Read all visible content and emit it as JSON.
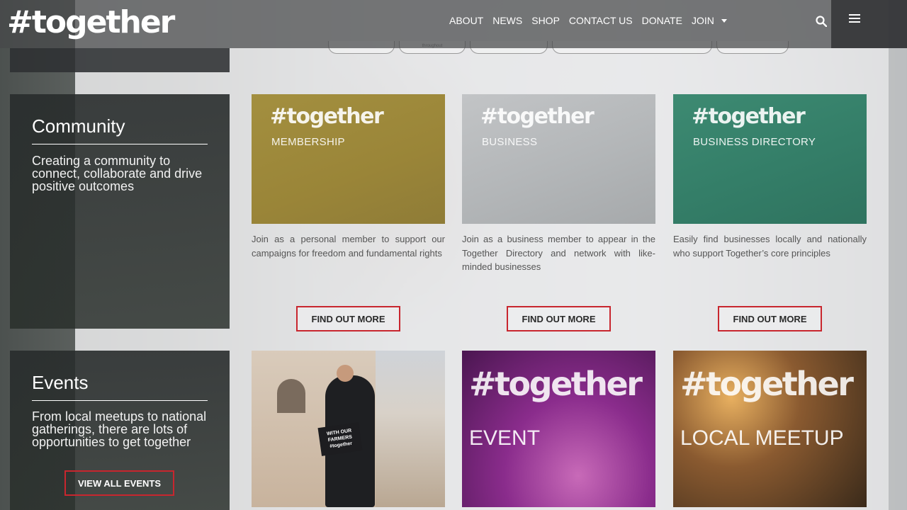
{
  "header": {
    "logo": "#together",
    "nav": [
      {
        "label": "ABOUT"
      },
      {
        "label": "NEWS"
      },
      {
        "label": "SHOP"
      },
      {
        "label": "CONTACT US"
      },
      {
        "label": "DONATE"
      },
      {
        "label": "JOIN"
      }
    ]
  },
  "pills": {
    "second_label": "throughout"
  },
  "community": {
    "title": "Community",
    "description": "Creating a community to connect, collaborate and drive positive outcomes"
  },
  "tiles": [
    {
      "logo": "#together",
      "subtitle": "MEMBERSHIP",
      "description": "Join as a personal member to support our campaigns for freedom and fundamental rights",
      "button": "FIND OUT MORE",
      "color": "#a48f3c"
    },
    {
      "logo": "#together",
      "subtitle": "BUSINESS",
      "description": "Join as a business member to appear in the Together Directory and network with like-minded businesses",
      "button": "FIND OUT MORE",
      "color": "#b5b8bb"
    },
    {
      "logo": "#together",
      "subtitle": "BUSINESS DIRECTORY",
      "description": "Easily find businesses locally and nationally who support Together’s core principles",
      "button": "FIND OUT MORE",
      "color": "#3a8770"
    }
  ],
  "events": {
    "title": "Events",
    "description": "From local meetups to national gatherings, there are lots of opportunities to get together",
    "button": "VIEW ALL EVENTS"
  },
  "event_tiles": [
    {
      "sign": "WITH OUR FARMERS #together"
    },
    {
      "logo": "#together",
      "subtitle": "EVENT",
      "color": "#8a2c8c"
    },
    {
      "logo": "#together",
      "subtitle": "LOCAL MEETUP",
      "color": "#6a4a2a"
    }
  ],
  "colors": {
    "accent": "#c8262e",
    "dark_panel": "#2c302f"
  }
}
